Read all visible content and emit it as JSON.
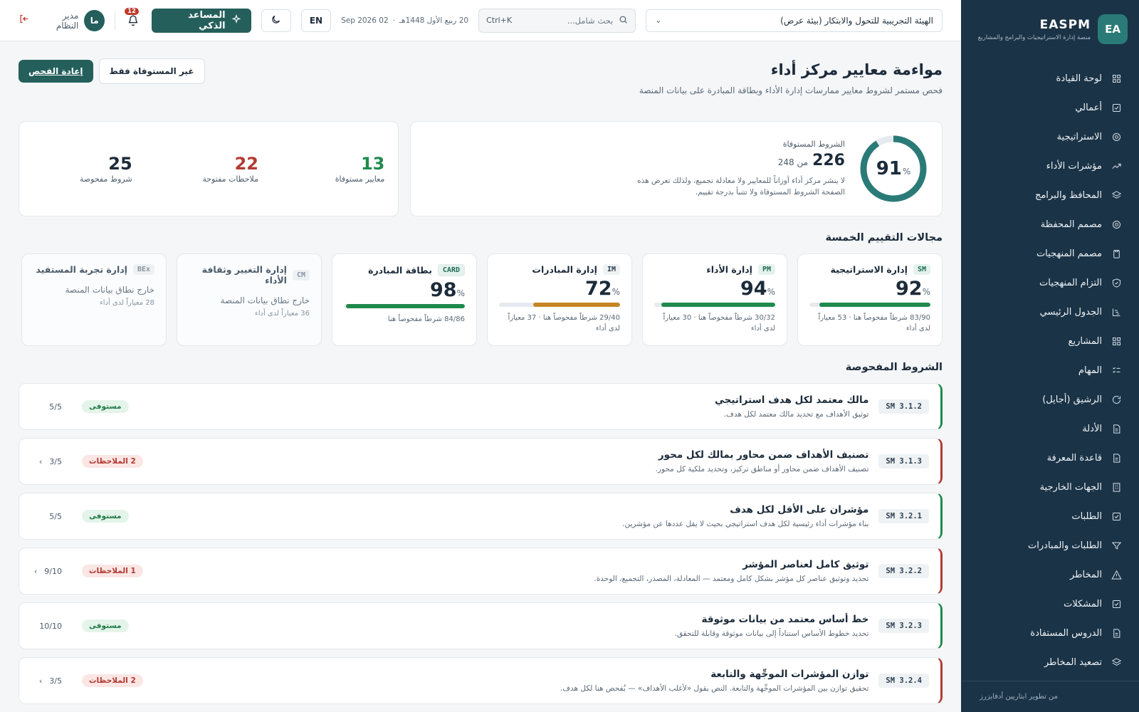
{
  "brand": {
    "logo": "EA",
    "name": "EASPM",
    "subtitle": "منصة إدارة الاستراتيجيات والبرامج والمشاريع"
  },
  "sidebar": {
    "items": [
      {
        "label": "لوحة القيادة",
        "icon": "grid-icon"
      },
      {
        "label": "أعمالي",
        "icon": "check-square-icon"
      },
      {
        "label": "الاستراتيجية",
        "icon": "target-icon"
      },
      {
        "label": "مؤشرات الأداء",
        "icon": "trend-icon"
      },
      {
        "label": "المحافظ والبرامج",
        "icon": "layers-icon"
      },
      {
        "label": "مصمم المحفظة",
        "icon": "target-icon"
      },
      {
        "label": "مصمم المنهجيات",
        "icon": "clipboard-icon"
      },
      {
        "label": "التزام المنهجيات",
        "icon": "shield-icon"
      },
      {
        "label": "الجدول الرئيسي",
        "icon": "gantt-icon"
      },
      {
        "label": "المشاريع",
        "icon": "grid-icon"
      },
      {
        "label": "المهام",
        "icon": "list-check-icon"
      },
      {
        "label": "الرشيق (أجايل)",
        "icon": "refresh-icon"
      },
      {
        "label": "الأدلة",
        "icon": "file-icon"
      },
      {
        "label": "قاعدة المعرفة",
        "icon": "file-icon"
      },
      {
        "label": "الجهات الخارجية",
        "icon": "building-icon"
      },
      {
        "label": "الطلبات",
        "icon": "check-square-icon"
      },
      {
        "label": "الطلبات والمبادرات",
        "icon": "filter-icon"
      },
      {
        "label": "المخاطر",
        "icon": "warning-icon"
      },
      {
        "label": "المشكلات",
        "icon": "check-square-icon"
      },
      {
        "label": "الدروس المستفادة",
        "icon": "file-icon"
      },
      {
        "label": "تصعيد المخاطر",
        "icon": "layers-icon"
      }
    ],
    "footer": "من تطوير ابتاريين أدفايزرز"
  },
  "topbar": {
    "org": "الهيئة التجريبية للتحول والابتكار (بيئة عرض)",
    "search_placeholder": "بحث شامل...",
    "search_shortcut": "Ctrl+K",
    "hijri_date": "20 ربيع الأول 1448هـ",
    "greg_date": "02 Sep 2026",
    "lang": "EN",
    "ai_label": "المساعد الذكي",
    "notif_count": "12",
    "user_initials": "ما",
    "user_role": "مدير النظام"
  },
  "page": {
    "title": "مواءمة معايير مركز أداء",
    "subtitle": "فحص مستمر لشروط معايير ممارسات إدارة الأداء وبطاقة المبادرة على بيانات المنصة",
    "filter_label": "غير المستوفاة فقط",
    "recheck_label": "إعادة الفحص"
  },
  "summary": {
    "percent": "91",
    "percent_value": 0.91,
    "percent_sign": "%",
    "met_label": "الشروط المستوفاة",
    "met": "226",
    "of_label": "من 248",
    "note": "لا ينشر مركز أداء أوزاناً للمعايير ولا معادلة تجميع، ولذلك تعرض هذه الصفحة الشروط المستوفاة ولا تتنبأ بدرجة تقييم.",
    "stats": [
      {
        "value": "13",
        "label": "معايير مستوفاة",
        "tone": "green"
      },
      {
        "value": "22",
        "label": "ملاحظات مفتوحة",
        "tone": "red"
      },
      {
        "value": "25",
        "label": "شروط مفحوصة",
        "tone": "navy"
      }
    ]
  },
  "domains_title": "مجالات التقييم الخمسة",
  "domains": [
    {
      "code": "SM",
      "name": "إدارة الاستراتيجية",
      "pct": "92",
      "fill": 0.92,
      "color": "#1f8a4c",
      "meta": "83/90 شرطاً مفحوصاً هنا · 53 معياراً لدى أداء",
      "cls": "sm"
    },
    {
      "code": "PM",
      "name": "إدارة الأداء",
      "pct": "94",
      "fill": 0.94,
      "color": "#1f8a4c",
      "meta": "30/32 شرطاً مفحوصاً هنا · 30 معياراً لدى أداء",
      "cls": "pm"
    },
    {
      "code": "IM",
      "name": "إدارة المبادرات",
      "pct": "72",
      "fill": 0.72,
      "color": "#c78424",
      "meta": "29/40 شرطاً مفحوصاً هنا · 37 معياراً لدى أداء",
      "cls": "im"
    },
    {
      "code": "CARD",
      "name": "بطاقة المبادرة",
      "pct": "98",
      "fill": 0.98,
      "color": "#1f8a4c",
      "meta": "84/86 شرطاً مفحوصاً هنا",
      "cls": "card"
    },
    {
      "code": "CM",
      "name": "إدارة التغيير وثقافة الأداء",
      "out": "خارج نطاق بيانات المنصة",
      "out_sub": "36 معياراً لدى أداء",
      "cls": "gray"
    },
    {
      "code": "BEx",
      "name": "إدارة تجربة المستفيد",
      "out": "خارج نطاق بيانات المنصة",
      "out_sub": "28 معياراً لدى أداء",
      "cls": "gray"
    }
  ],
  "criteria_title": "الشروط المفحوصة",
  "criteria": [
    {
      "code": "SM 3.1.2",
      "title": "مالك معتمد لكل هدف استراتيجي",
      "desc": "توثيق الأهداف مع تحديد مالك معتمد لكل هدف.",
      "status": "مستوفى",
      "ok": true,
      "score": "5/5"
    },
    {
      "code": "SM 3.1.3",
      "title": "تصنيف الأهداف ضمن محاور بمالك لكل محور",
      "desc": "تصنيف الأهداف ضمن محاور أو مناطق تركيز، وتحديد ملكية كل محور.",
      "status": "2 الملاحظات",
      "ok": false,
      "score": "3/5"
    },
    {
      "code": "SM 3.2.1",
      "title": "مؤشران على الأقل لكل هدف",
      "desc": "بناء مؤشرات أداء رئيسية لكل هدف استراتيجي بحيث لا يقل عددها عن مؤشرين.",
      "status": "مستوفى",
      "ok": true,
      "score": "5/5"
    },
    {
      "code": "SM 3.2.2",
      "title": "توثيق كامل لعناصر المؤشر",
      "desc": "تحديد وتوثيق عناصر كل مؤشر بشكل كامل ومعتمد — المعادلة، المصدر، التجميع، الوحدة.",
      "status": "1 الملاحظات",
      "ok": false,
      "score": "9/10"
    },
    {
      "code": "SM 3.2.3",
      "title": "خط أساس معتمد من بيانات موثوقة",
      "desc": "تحديد خطوط الأساس استناداً إلى بيانات موثوقة وقابلة للتحقق.",
      "status": "مستوفى",
      "ok": true,
      "score": "10/10"
    },
    {
      "code": "SM 3.2.4",
      "title": "توازن المؤشرات الموجِّهة والتابعة",
      "desc": "تحقيق توازن بين المؤشرات الموجِّهة والتابعة. النص يقول «لأغلب الأهداف» — يُفحص هنا لكل هدف.",
      "status": "2 الملاحظات",
      "ok": false,
      "score": "3/5"
    }
  ]
}
